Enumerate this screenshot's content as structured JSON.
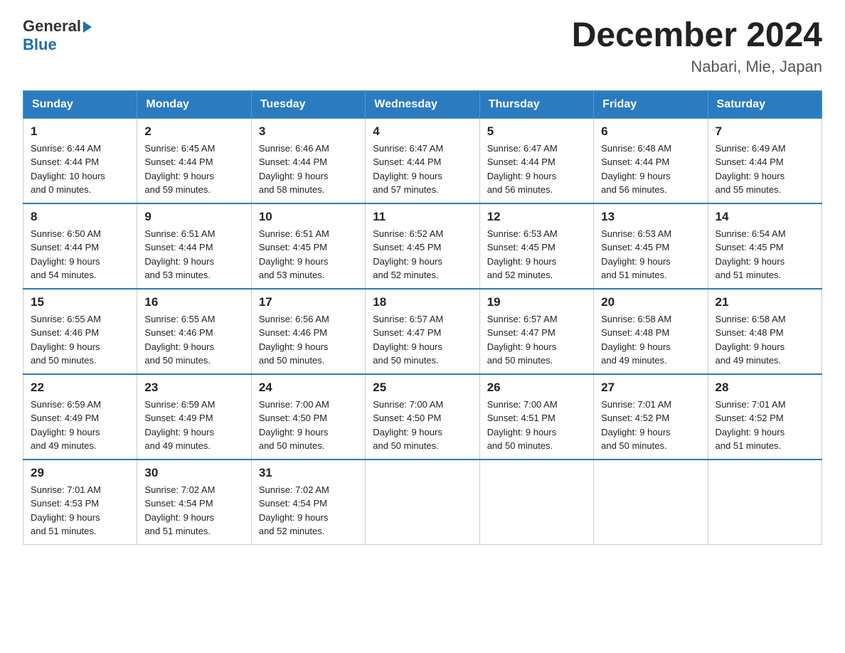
{
  "header": {
    "logo_general": "General",
    "logo_blue": "Blue",
    "month_year": "December 2024",
    "location": "Nabari, Mie, Japan"
  },
  "days_of_week": [
    "Sunday",
    "Monday",
    "Tuesday",
    "Wednesday",
    "Thursday",
    "Friday",
    "Saturday"
  ],
  "weeks": [
    [
      {
        "day": "1",
        "sunrise": "6:44 AM",
        "sunset": "4:44 PM",
        "daylight_h": "10",
        "daylight_m": "0"
      },
      {
        "day": "2",
        "sunrise": "6:45 AM",
        "sunset": "4:44 PM",
        "daylight_h": "9",
        "daylight_m": "59"
      },
      {
        "day": "3",
        "sunrise": "6:46 AM",
        "sunset": "4:44 PM",
        "daylight_h": "9",
        "daylight_m": "58"
      },
      {
        "day": "4",
        "sunrise": "6:47 AM",
        "sunset": "4:44 PM",
        "daylight_h": "9",
        "daylight_m": "57"
      },
      {
        "day": "5",
        "sunrise": "6:47 AM",
        "sunset": "4:44 PM",
        "daylight_h": "9",
        "daylight_m": "56"
      },
      {
        "day": "6",
        "sunrise": "6:48 AM",
        "sunset": "4:44 PM",
        "daylight_h": "9",
        "daylight_m": "56"
      },
      {
        "day": "7",
        "sunrise": "6:49 AM",
        "sunset": "4:44 PM",
        "daylight_h": "9",
        "daylight_m": "55"
      }
    ],
    [
      {
        "day": "8",
        "sunrise": "6:50 AM",
        "sunset": "4:44 PM",
        "daylight_h": "9",
        "daylight_m": "54"
      },
      {
        "day": "9",
        "sunrise": "6:51 AM",
        "sunset": "4:44 PM",
        "daylight_h": "9",
        "daylight_m": "53"
      },
      {
        "day": "10",
        "sunrise": "6:51 AM",
        "sunset": "4:45 PM",
        "daylight_h": "9",
        "daylight_m": "53"
      },
      {
        "day": "11",
        "sunrise": "6:52 AM",
        "sunset": "4:45 PM",
        "daylight_h": "9",
        "daylight_m": "52"
      },
      {
        "day": "12",
        "sunrise": "6:53 AM",
        "sunset": "4:45 PM",
        "daylight_h": "9",
        "daylight_m": "52"
      },
      {
        "day": "13",
        "sunrise": "6:53 AM",
        "sunset": "4:45 PM",
        "daylight_h": "9",
        "daylight_m": "51"
      },
      {
        "day": "14",
        "sunrise": "6:54 AM",
        "sunset": "4:45 PM",
        "daylight_h": "9",
        "daylight_m": "51"
      }
    ],
    [
      {
        "day": "15",
        "sunrise": "6:55 AM",
        "sunset": "4:46 PM",
        "daylight_h": "9",
        "daylight_m": "50"
      },
      {
        "day": "16",
        "sunrise": "6:55 AM",
        "sunset": "4:46 PM",
        "daylight_h": "9",
        "daylight_m": "50"
      },
      {
        "day": "17",
        "sunrise": "6:56 AM",
        "sunset": "4:46 PM",
        "daylight_h": "9",
        "daylight_m": "50"
      },
      {
        "day": "18",
        "sunrise": "6:57 AM",
        "sunset": "4:47 PM",
        "daylight_h": "9",
        "daylight_m": "50"
      },
      {
        "day": "19",
        "sunrise": "6:57 AM",
        "sunset": "4:47 PM",
        "daylight_h": "9",
        "daylight_m": "50"
      },
      {
        "day": "20",
        "sunrise": "6:58 AM",
        "sunset": "4:48 PM",
        "daylight_h": "9",
        "daylight_m": "49"
      },
      {
        "day": "21",
        "sunrise": "6:58 AM",
        "sunset": "4:48 PM",
        "daylight_h": "9",
        "daylight_m": "49"
      }
    ],
    [
      {
        "day": "22",
        "sunrise": "6:59 AM",
        "sunset": "4:49 PM",
        "daylight_h": "9",
        "daylight_m": "49"
      },
      {
        "day": "23",
        "sunrise": "6:59 AM",
        "sunset": "4:49 PM",
        "daylight_h": "9",
        "daylight_m": "49"
      },
      {
        "day": "24",
        "sunrise": "7:00 AM",
        "sunset": "4:50 PM",
        "daylight_h": "9",
        "daylight_m": "50"
      },
      {
        "day": "25",
        "sunrise": "7:00 AM",
        "sunset": "4:50 PM",
        "daylight_h": "9",
        "daylight_m": "50"
      },
      {
        "day": "26",
        "sunrise": "7:00 AM",
        "sunset": "4:51 PM",
        "daylight_h": "9",
        "daylight_m": "50"
      },
      {
        "day": "27",
        "sunrise": "7:01 AM",
        "sunset": "4:52 PM",
        "daylight_h": "9",
        "daylight_m": "50"
      },
      {
        "day": "28",
        "sunrise": "7:01 AM",
        "sunset": "4:52 PM",
        "daylight_h": "9",
        "daylight_m": "51"
      }
    ],
    [
      {
        "day": "29",
        "sunrise": "7:01 AM",
        "sunset": "4:53 PM",
        "daylight_h": "9",
        "daylight_m": "51"
      },
      {
        "day": "30",
        "sunrise": "7:02 AM",
        "sunset": "4:54 PM",
        "daylight_h": "9",
        "daylight_m": "51"
      },
      {
        "day": "31",
        "sunrise": "7:02 AM",
        "sunset": "4:54 PM",
        "daylight_h": "9",
        "daylight_m": "52"
      },
      null,
      null,
      null,
      null
    ]
  ]
}
